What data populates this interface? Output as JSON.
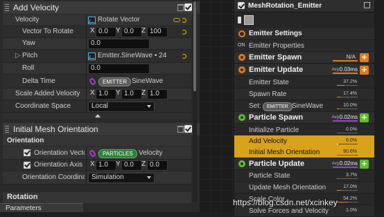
{
  "left": {
    "add_velocity": {
      "title": "Add Velocity",
      "rows": {
        "velocity": {
          "label": "Velocity",
          "value": "Rotate Vector"
        },
        "vector_to_rotate": {
          "label": "Vector To Rotate",
          "x": "0.0",
          "y": "0.0",
          "z": "100"
        },
        "yaw": {
          "label": "Yaw",
          "value": "0.0"
        },
        "pitch": {
          "label": "Pitch",
          "value": "Emitter.SineWave • 24"
        },
        "roll": {
          "label": "Roll",
          "value": "0.0"
        },
        "delta_time": {
          "label": "Delta Time",
          "badge": "EMITTER",
          "value": "SineWave"
        },
        "scale_added_velocity": {
          "label": "Scale Added Velocity",
          "x": "1.0",
          "y": "1.0",
          "z": "1.0"
        },
        "coordinate_space": {
          "label": "Coordinate Space",
          "value": "Local"
        }
      }
    },
    "initial_mesh_orientation": {
      "title": "Initial Mesh Orientation",
      "subsection": "Orientation",
      "rows": {
        "orientation_vector": {
          "label": "Orientation Vecto",
          "badge": "PARTICLES",
          "value": "Velocity"
        },
        "orientation_axis": {
          "label": "Orientation Axis",
          "x": "1.0",
          "y": "0.0",
          "z": "0.0"
        },
        "orientation_coordinate": {
          "label": "Orientation Coordinat",
          "value": "Simulation"
        }
      },
      "next_subsection": "Rotation"
    },
    "bottom_tab": "Parameters",
    "axis_letters": {
      "x": "X",
      "y": "Y",
      "z": "Z"
    }
  },
  "right": {
    "title": "MeshRotation_Emitter",
    "items": {
      "emitter_settings": "Emitter Settings",
      "emitter_properties": "Emitter Properties",
      "emitter_spawn": {
        "label": "Emitter Spawn",
        "stat": "N/A"
      },
      "emitter_update": {
        "label": "Emitter Update",
        "avg_label": "Avg",
        "avg": "0.03ms"
      },
      "emitter_state": {
        "label": "Emitter State",
        "pct": "37.2%"
      },
      "spawn_rate": {
        "label": "Spawn Rate",
        "pct": "17.4%"
      },
      "set": {
        "label": "Set:",
        "badge": "EMITTER",
        "value": "SineWave",
        "pct": "10.0%"
      },
      "particle_spawn": {
        "label": "Particle Spawn",
        "avg_label": "Avg",
        "avg": "0.02ms"
      },
      "initialize_particle": {
        "label": "Initialize Particle",
        "pct": "0.0%"
      },
      "add_velocity": {
        "label": "Add Velocity",
        "pct": "6.0%"
      },
      "initial_mesh_orientation": {
        "label": "Initial Mesh Orientation",
        "pct": "90.6%"
      },
      "particle_update": {
        "label": "Particle Update",
        "avg_label": "Avg",
        "avg": "0.02ms"
      },
      "particle_state": {
        "label": "Particle State",
        "pct": "3.7%"
      },
      "update_mesh_orientation": {
        "label": "Update Mesh Orientation",
        "pct": "17.0%"
      },
      "scale_color": {
        "label": "Scale Color",
        "pct": "54.2%"
      },
      "solve_forces": {
        "label": "Solve Forces and Velocity",
        "pct": "1.0%"
      }
    },
    "plus_symbol": "+"
  },
  "watermark": "https://blog.csdn.net/xcinkey",
  "colors": {
    "orange": "#e07a1f",
    "green": "#5fbf2a",
    "purple": "#a040c8",
    "highlight": "#d9a21b"
  },
  "icons": [
    "grip-icon",
    "trash-icon",
    "checkbox-icon",
    "curve-icon",
    "link-icon",
    "reset-icon",
    "chevron-right-icon",
    "plus-icon",
    "pin-icon",
    "expand-icon"
  ]
}
